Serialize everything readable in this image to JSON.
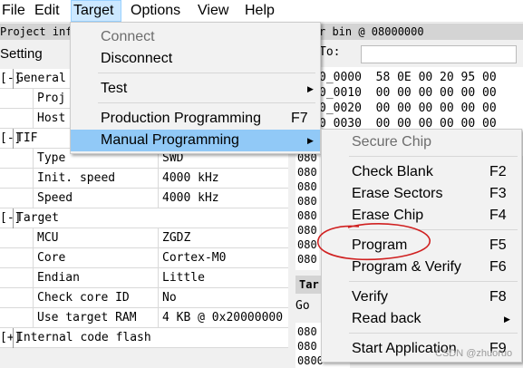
{
  "menubar": [
    "File",
    "Edit",
    "Target",
    "Options",
    "View",
    "Help"
  ],
  "left_panel": {
    "header": "Project info",
    "tab": "Setting",
    "rows": [
      {
        "expand": "[-]",
        "label": "General",
        "value": ""
      },
      {
        "label": "Proj",
        "value": ""
      },
      {
        "label": "Host",
        "value": ""
      },
      {
        "expand": "[-]",
        "label": "TIF",
        "value": ""
      },
      {
        "label": "Type",
        "value": "SWD"
      },
      {
        "label": "Init. speed",
        "value": "4000 kHz"
      },
      {
        "label": "Speed",
        "value": "4000 kHz"
      },
      {
        "expand": "[-]",
        "label": "Target",
        "value": ""
      },
      {
        "label": "MCU",
        "value": "ZGDZ"
      },
      {
        "label": "Core",
        "value": "Cortex-M0"
      },
      {
        "label": "Endian",
        "value": "Little"
      },
      {
        "label": "Check core ID",
        "value": "No"
      },
      {
        "label": "Use target RAM",
        "value": "4 KB @ 0x20000000"
      },
      {
        "expand": "[+]",
        "label": "Internal code flash",
        "value": ""
      }
    ]
  },
  "right_panel": {
    "header": "r            bin @ 08000000",
    "to_label": "To:",
    "hex_rows": [
      "0_0000  58 0E 00 20 95 00",
      "0_0010  00 00 00 00 00 00",
      "0_0020  00 00 00 00 00 00",
      "0_0030  00 00 00 00 00 00"
    ],
    "hex_col": [
      "080",
      "080",
      "080",
      "080",
      "080",
      "080",
      "080",
      "080"
    ],
    "target_tab": "Tar",
    "go_label": "Go",
    "hex_col2": [
      "080",
      "080",
      "0800"
    ]
  },
  "target_menu": {
    "items": [
      {
        "label": "Connect",
        "disabled": true
      },
      {
        "label": "Disconnect"
      },
      {
        "label": "Test",
        "submenu": true
      },
      {
        "label": "Production Programming",
        "shortcut": "F7"
      },
      {
        "label": "Manual Programming",
        "submenu": true,
        "highlighted": true
      }
    ]
  },
  "manual_menu": {
    "items": [
      {
        "label": "Secure Chip",
        "disabled": true
      },
      {
        "label": "Check Blank",
        "shortcut": "F2"
      },
      {
        "label": "Erase Sectors",
        "shortcut": "F3"
      },
      {
        "label": "Erase Chip",
        "shortcut": "F4"
      },
      {
        "label": "Program",
        "shortcut": "F5"
      },
      {
        "label": "Program & Verify",
        "shortcut": "F6"
      },
      {
        "label": "Verify",
        "shortcut": "F8"
      },
      {
        "label": "Read back",
        "submenu": true
      },
      {
        "label": "Start Application",
        "shortcut": "F9"
      }
    ]
  },
  "watermark": "CSDN @zhuoruo",
  "colors": {
    "highlight": "#91c9f7",
    "menu_bg": "#f2f2f2",
    "annotation": "#d02020"
  }
}
